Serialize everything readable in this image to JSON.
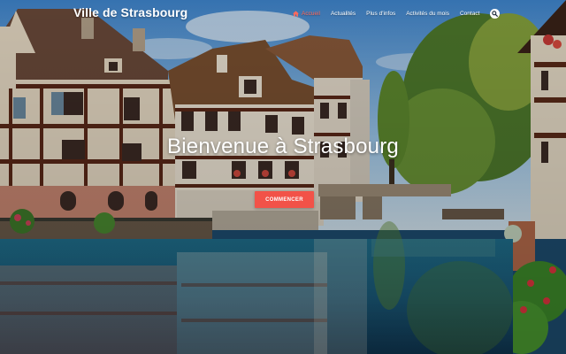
{
  "header": {
    "site_title": "Ville de Strasbourg"
  },
  "nav": {
    "items": [
      {
        "label": "Accueil",
        "active": true,
        "icon": "home-icon"
      },
      {
        "label": "Actualités",
        "active": false
      },
      {
        "label": "Plus d'infos",
        "active": false
      },
      {
        "label": "Activités du mois",
        "active": false
      },
      {
        "label": "Contact",
        "active": false
      }
    ],
    "search_icon": "search-icon"
  },
  "hero": {
    "title": "Bienvenue à Strasbourg",
    "cta_label": "COMMENCER",
    "background": "half-timbered-houses-canal-photo"
  },
  "colors": {
    "accent": "#f25248",
    "active_nav": "#ff6a5c",
    "text": "#ffffff"
  }
}
